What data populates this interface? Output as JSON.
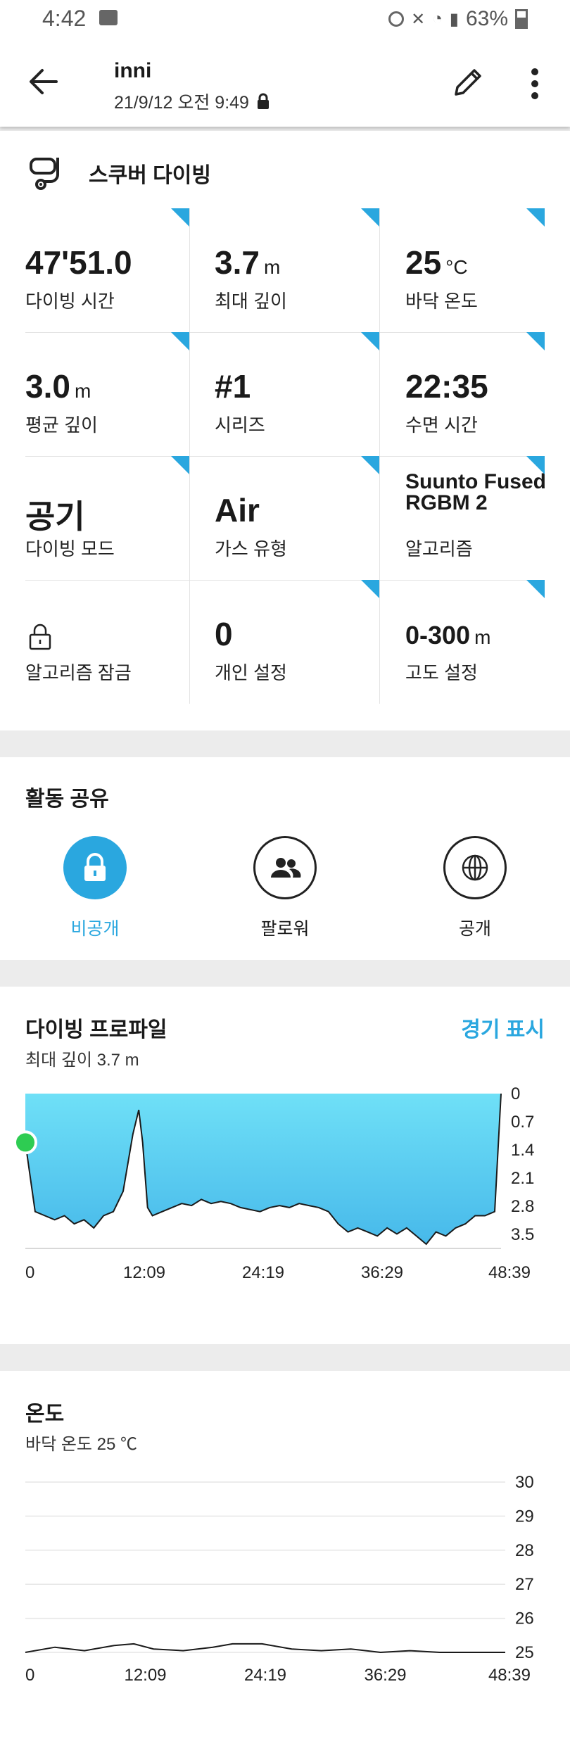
{
  "status_bar": {
    "time": "4:42",
    "battery": "63%"
  },
  "header": {
    "user": "inni",
    "date": "21/9/12 오전 9:49"
  },
  "dive": {
    "activity": "스쿠버 다이빙",
    "stats": [
      {
        "value": "47'51.0",
        "unit": "",
        "label": "다이빙 시간"
      },
      {
        "value": "3.7",
        "unit": "m",
        "label": "최대 깊이"
      },
      {
        "value": "25",
        "unit": "°C",
        "label": "바닥 온도"
      },
      {
        "value": "3.0",
        "unit": "m",
        "label": "평균 깊이"
      },
      {
        "value": "#1",
        "unit": "",
        "label": "시리즈"
      },
      {
        "value": "22:35",
        "unit": "",
        "label": "수면 시간"
      },
      {
        "value": "공기",
        "unit": "",
        "label": "다이빙 모드"
      },
      {
        "value": "Air",
        "unit": "",
        "label": "가스 유형"
      },
      {
        "value": "Suunto Fused RGBM 2",
        "unit": "",
        "label": "알고리즘"
      },
      {
        "value": "",
        "unit": "",
        "label": "알고리즘 잠금"
      },
      {
        "value": "0",
        "unit": "",
        "label": "개인 설정"
      },
      {
        "value": "0-300",
        "unit": "m",
        "label": "고도 설정"
      }
    ]
  },
  "share": {
    "title": "활동 공유",
    "options": [
      {
        "label": "비공개",
        "selected": true,
        "icon": "lock-icon"
      },
      {
        "label": "팔로워",
        "selected": false,
        "icon": "people-icon"
      },
      {
        "label": "공개",
        "selected": false,
        "icon": "globe-icon"
      }
    ],
    "accent": "#2aa7df"
  },
  "profile": {
    "title": "다이빙 프로파일",
    "link": "경기 표시",
    "subtitle": "최대 깊이 3.7 m"
  },
  "temperature": {
    "title": "온도",
    "subtitle": "바닥 온도 25 ℃"
  },
  "chart_data": [
    {
      "type": "area",
      "x_tick_labels": [
        "0",
        "12:09",
        "24:19",
        "36:29",
        "48:39"
      ],
      "y_tick_labels": [
        "0",
        "0.7",
        "1.4",
        "2.1",
        "2.8",
        "3.5"
      ],
      "ylim": [
        0,
        3.7
      ],
      "y_inverted": true,
      "x_minutes": [
        0,
        1,
        2,
        3,
        4,
        5,
        6,
        7,
        8,
        9,
        10,
        11,
        11.6,
        12,
        12.5,
        13,
        14,
        15,
        16,
        17,
        18,
        19,
        20,
        21,
        22,
        23,
        24,
        25,
        26,
        27,
        28,
        29,
        30,
        31,
        32,
        33,
        34,
        35,
        36,
        37,
        38,
        39,
        40,
        41,
        42,
        43,
        44,
        45,
        46,
        47,
        48,
        48.65
      ],
      "depth_m": [
        1.2,
        2.9,
        3.0,
        3.1,
        3.0,
        3.2,
        3.1,
        3.3,
        3.0,
        2.9,
        2.4,
        1.0,
        0.4,
        1.2,
        2.8,
        3.0,
        2.9,
        2.8,
        2.7,
        2.75,
        2.6,
        2.7,
        2.65,
        2.7,
        2.8,
        2.85,
        2.9,
        2.8,
        2.75,
        2.8,
        2.7,
        2.75,
        2.8,
        2.9,
        3.2,
        3.4,
        3.3,
        3.4,
        3.5,
        3.3,
        3.45,
        3.3,
        3.5,
        3.7,
        3.4,
        3.5,
        3.3,
        3.2,
        3.0,
        3.0,
        2.9,
        0.0
      ],
      "marker": {
        "x_minutes": 0,
        "depth_m": 1.2,
        "color": "#2ecc52"
      }
    },
    {
      "type": "line",
      "x_tick_labels": [
        "0",
        "12:09",
        "24:19",
        "36:29",
        "48:39"
      ],
      "y_tick_labels": [
        "30",
        "29",
        "28",
        "27",
        "26",
        "25"
      ],
      "ylim": [
        25,
        30
      ],
      "x_minutes": [
        0,
        3,
        6,
        9,
        11,
        13,
        16,
        19,
        21,
        24,
        27,
        30,
        33,
        36,
        39,
        42,
        45,
        48.65
      ],
      "temperature_c": [
        25.0,
        25.15,
        25.05,
        25.2,
        25.25,
        25.1,
        25.05,
        25.15,
        25.25,
        25.25,
        25.1,
        25.05,
        25.1,
        25.0,
        25.05,
        25.0,
        25.0,
        25.0
      ]
    }
  ]
}
